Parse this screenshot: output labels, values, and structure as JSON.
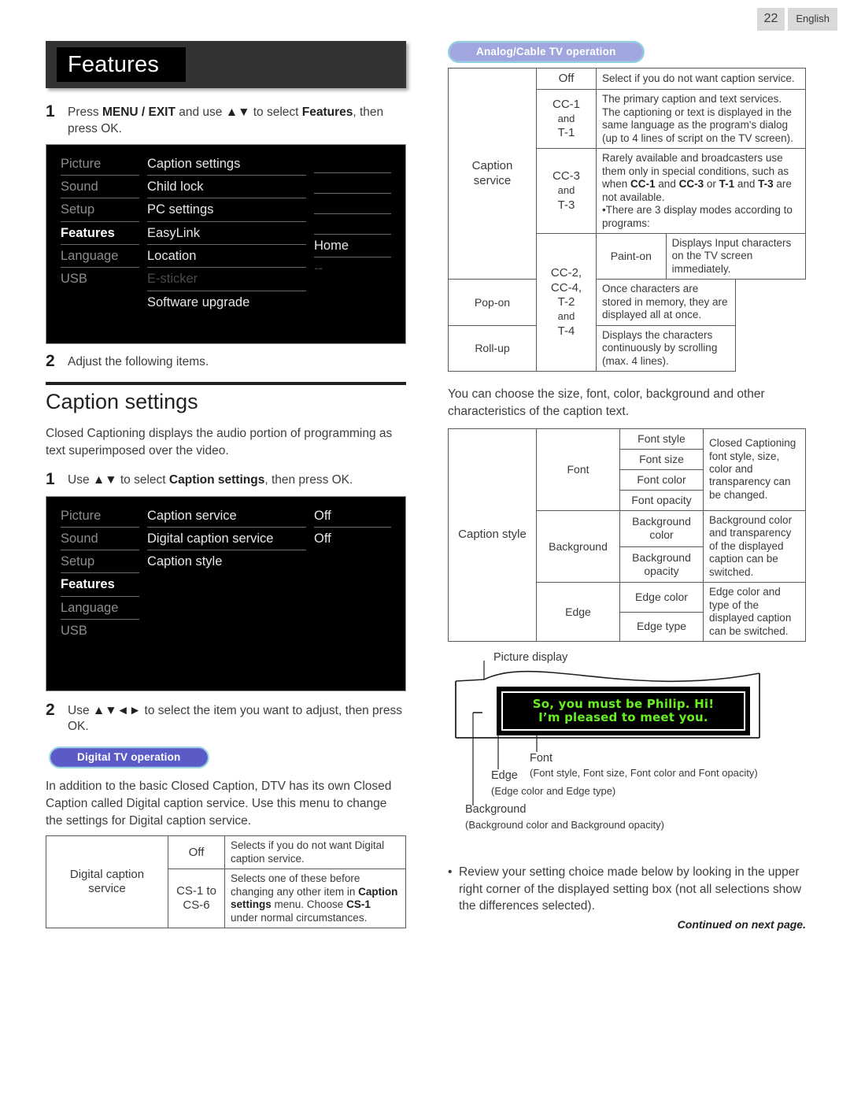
{
  "header": {
    "page_number": "22",
    "language": "English"
  },
  "left": {
    "title": "Features",
    "step1": {
      "num": "1",
      "text_pre": "Press ",
      "text_b1": "MENU / EXIT",
      "text_mid": " and use ",
      "arrows": "▲▼",
      "text_mid2": " to select ",
      "text_b2": "Features",
      "text_end": ", then press OK."
    },
    "menu1": {
      "categories": [
        "Picture",
        "Sound",
        "Setup",
        "Features",
        "Language",
        "USB"
      ],
      "items": [
        "Caption settings",
        "Child lock",
        "PC settings",
        "EasyLink",
        "Location",
        "E-sticker",
        "Software upgrade"
      ],
      "values": [
        "",
        "",
        "",
        "",
        "Home",
        "--",
        ""
      ],
      "selected_category": "Features",
      "disabled_item": "E-sticker"
    },
    "step2": {
      "num": "2",
      "text": "Adjust the following items."
    },
    "section_heading": "Caption settings",
    "intro": "Closed Captioning displays the audio portion of programming as text superimposed over the video.",
    "step3": {
      "num": "1",
      "text_pre": "Use ",
      "arrows": "▲▼",
      "text_mid": " to select ",
      "text_b": "Caption settings",
      "text_end": ", then press OK."
    },
    "menu2": {
      "categories": [
        "Picture",
        "Sound",
        "Setup",
        "Features",
        "Language",
        "USB"
      ],
      "items": [
        "Caption service",
        "Digital caption service",
        "Caption style"
      ],
      "values": [
        "Off",
        "Off",
        ""
      ],
      "selected_category": "Features"
    },
    "step4": {
      "num": "2",
      "text_pre": "Use ",
      "arrows": "▲▼◄►",
      "text_end": " to select the item you want to adjust, then press OK."
    },
    "badge_digital": "Digital TV operation",
    "digital_intro_1": "In addition to the basic Closed Caption, DTV has its own Closed",
    "digital_intro_2": "Caption called Digital caption service. Use this menu to change the",
    "digital_intro_3": "settings for Digital caption service.",
    "digital_table": {
      "row_label": "Digital caption service",
      "rows": [
        {
          "key": "Off",
          "desc_pre": "Selects if you do not want Digital caption service.",
          "desc_b1": "",
          "desc_mid": "",
          "desc_b2": "",
          "desc_end": ""
        },
        {
          "key_line1": "CS-1 to",
          "key_line2": "CS-6",
          "desc_pre": "Selects one of these before changing any other item in ",
          "desc_b1": "Caption settings",
          "desc_mid": " menu. Choose ",
          "desc_b2": "CS-1",
          "desc_end": " under normal circumstances."
        }
      ]
    }
  },
  "right": {
    "badge_analog": "Analog/Cable TV operation",
    "analog_table": {
      "row_label": "Caption service",
      "rows": [
        {
          "key": "Off",
          "desc": "Select if you do not want caption service."
        },
        {
          "key_lines": [
            "CC-1",
            "and",
            "T-1"
          ],
          "desc": "The primary caption and text services. The captioning or text is displayed in the same language as the program's dialog (up to 4 lines of script on the TV screen)."
        },
        {
          "key_lines": [
            "CC-3",
            "and",
            "T-3"
          ],
          "desc_pre": "Rarely available and broadcasters use them only in special conditions, such as when ",
          "desc_b1": "CC-1",
          "desc_m1": " and ",
          "desc_b2": "CC-3",
          "desc_m2": " or ",
          "desc_b3": "T-1",
          "desc_m3": " and ",
          "desc_b4": "T-3",
          "desc_end": " are not available.",
          "desc_bullet": "•There are 3 display modes according to programs:"
        }
      ],
      "modes_key_lines": [
        "CC-2,",
        "CC-4,",
        "T-2",
        "and",
        "T-4"
      ],
      "modes": [
        {
          "name": "Paint-on",
          "desc": "Displays Input characters on the TV screen immediately."
        },
        {
          "name": "Pop-on",
          "desc": "Once characters are stored in memory, they are displayed all at once."
        },
        {
          "name": "Roll-up",
          "desc": "Displays the characters continuously by scrolling (max. 4 lines)."
        }
      ]
    },
    "style_intro_1": "You can choose the size, font, color, background and other",
    "style_intro_2": "characteristics of the caption text.",
    "style_table": {
      "row_label": "Caption style",
      "groups": [
        {
          "name": "Font",
          "items": [
            "Font style",
            "Font size",
            "Font color",
            "Font opacity"
          ],
          "desc": "Closed Captioning font style, size, color and transparency can be changed."
        },
        {
          "name": "Background",
          "items": [
            "Background color",
            "Background opacity"
          ],
          "desc": "Background color and transparency of the displayed caption can be switched."
        },
        {
          "name": "Edge",
          "items": [
            "Edge color",
            "Edge type"
          ],
          "desc": "Edge color and type of the displayed caption can be switched."
        }
      ]
    },
    "diagram": {
      "picture_display_label": "Picture display",
      "caption_line_1": "So, you must be Philip. Hi!",
      "caption_line_2": "I’m pleased to meet you.",
      "font_label": "Font",
      "font_sub": "(Font style, Font size, Font color and Font opacity)",
      "edge_label": "Edge",
      "edge_sub": "(Edge color and Edge type)",
      "background_label": "Background",
      "background_sub": "(Background color and Background opacity)",
      "caption_text_color": "#66ee22"
    },
    "bullet": "Review your setting choice made below by looking in the upper right corner of the displayed setting box (not all selections show the differences selected).",
    "continued": "Continued on next page."
  }
}
